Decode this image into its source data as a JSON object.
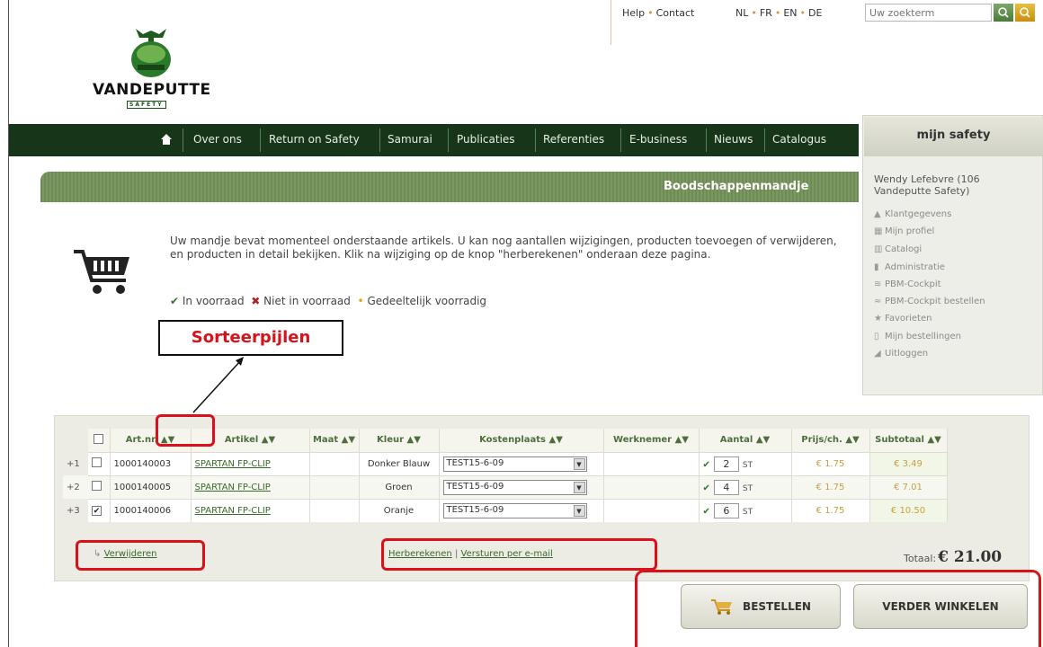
{
  "brand": {
    "name": "VANDEPUTTE",
    "tag": "SAFETY"
  },
  "header": {
    "help_label": "Help",
    "contact_label": "Contact",
    "languages": [
      "NL",
      "FR",
      "EN",
      "DE"
    ],
    "search_placeholder": "Uw zoekterm"
  },
  "nav": {
    "items": [
      "Over ons",
      "Return on Safety",
      "Samurai",
      "Publicaties",
      "Referenties",
      "E-business",
      "Nieuws",
      "Catalogus"
    ]
  },
  "mysafety": {
    "title": "mijn safety",
    "user": "Wendy Lefebvre (106 Vandeputte Safety)",
    "menu": [
      "Klantgegevens",
      "Mijn profiel",
      "Catalogi",
      "Administratie",
      "PBM-Cockpit",
      "PBM-Cockpit bestellen",
      "Favorieten",
      "Mijn bestellingen",
      "Uitloggen"
    ]
  },
  "page": {
    "title": "Boodschappenmandje",
    "intro": "Uw mandje bevat momenteel onderstaande artikels. U kan nog aantallen wijzigingen, producten toevoegen of verwijderen, en producten in detail bekijken. Klik na wijziging op de knop \"herberekenen\" onderaan deze pagina.",
    "legend": {
      "in_stock": "In voorraad",
      "out_of_stock": "Niet in voorraad",
      "partial": "Gedeeltelijk voorradig"
    }
  },
  "annotation": {
    "label": "Sorteerpijlen"
  },
  "table": {
    "columns": [
      "Art.nr.",
      "Artikel",
      "Maat",
      "Kleur",
      "Kostenplaats",
      "Werknemer",
      "Aantal",
      "Prijs/ch.",
      "Subtotaal"
    ],
    "sort_arrows": "▲▼",
    "rows": [
      {
        "idx": "+1",
        "checked": false,
        "artnr": "1000140003",
        "artikel": "SPARTAN FP-CLIP",
        "maat": "",
        "kleur": "Donker Blauw",
        "kostenplaats": "TEST15-6-09",
        "werknemer": "",
        "aantal": "2",
        "unit": "ST",
        "prijs": "€ 1.75",
        "subtotaal": "€ 3.49"
      },
      {
        "idx": "+2",
        "checked": false,
        "artnr": "1000140005",
        "artikel": "SPARTAN FP-CLIP",
        "maat": "",
        "kleur": "Groen",
        "kostenplaats": "TEST15-6-09",
        "werknemer": "",
        "aantal": "4",
        "unit": "ST",
        "prijs": "€ 1.75",
        "subtotaal": "€ 7.01"
      },
      {
        "idx": "+3",
        "checked": true,
        "artnr": "1000140006",
        "artikel": "SPARTAN FP-CLIP",
        "maat": "",
        "kleur": "Oranje",
        "kostenplaats": "TEST15-6-09",
        "werknemer": "",
        "aantal": "6",
        "unit": "ST",
        "prijs": "€ 1.75",
        "subtotaal": "€ 10.50"
      }
    ],
    "remove_label": "Verwijderen",
    "recalc_label": "Herberekenen",
    "email_label": "Versturen per e-mail",
    "total_label": "Totaal:",
    "total_value": "€ 21.00"
  },
  "buttons": {
    "order": "BESTELLEN",
    "continue": "VERDER WINKELEN"
  },
  "colors": {
    "nav_bg": "#173519",
    "annotation_red": "#d8121b",
    "price": "#c8a040"
  }
}
